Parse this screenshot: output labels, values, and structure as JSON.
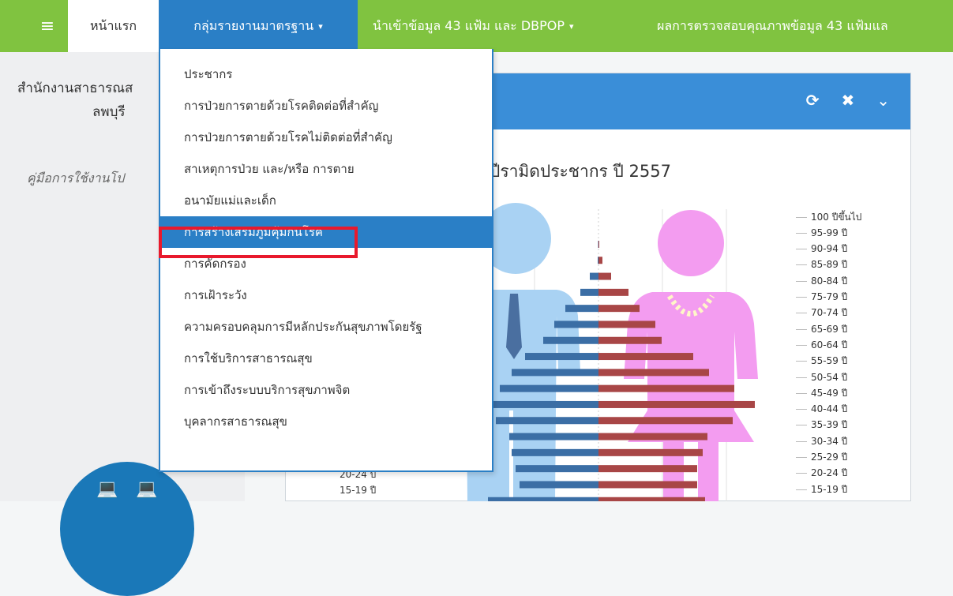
{
  "navbar": {
    "menu_icon": "≡",
    "home": "หน้าแรก",
    "standard_reports": "กลุ่มรายงานมาตรฐาน",
    "import_data": "นำเข้าข้อมูล 43 แฟ้ม และ DBPOP",
    "quality": "ผลการตรวจสอบคุณภาพข้อมูล 43 แฟ้มแล",
    "caret": "▾"
  },
  "sidebar": {
    "org_line1": "สำนักงานสาธารณส",
    "org_line2": "ลพบุรี",
    "manual": "คู่มือการใช้งานโป"
  },
  "dropdown": {
    "items": [
      {
        "label": "ประชากร"
      },
      {
        "label": "การป่วยการตายด้วยโรคติดต่อที่สำคัญ"
      },
      {
        "label": "การป่วยการตายด้วยโรคไม่ติดต่อที่สำคัญ"
      },
      {
        "label": "สาเหตุการป่วย และ/หรือ การตาย"
      },
      {
        "label": "อนามัยแม่และเด็ก"
      },
      {
        "label": "การสร้างเสริมภูมิคุ้มกันโรค"
      },
      {
        "label": "การคัดกรอง"
      },
      {
        "label": "การเฝ้าระวัง"
      },
      {
        "label": "ความครอบคลุมการมีหลักประกันสุขภาพโดยรัฐ"
      },
      {
        "label": "การใช้บริการสาธารณสุข"
      },
      {
        "label": "การเข้าถึงระบบบริการสุขภาพจิต"
      },
      {
        "label": "บุคลากรสาธารณสุข"
      }
    ],
    "active_index": 5
  },
  "panel": {
    "refresh_icon": "⟳",
    "close_icon": "✖",
    "collapse_icon": "⌄"
  },
  "chart_data": {
    "type": "bar",
    "title": "ปีรามิดประชากร ปี 2557",
    "categories": [
      "100 ปีขึ้นไป",
      "95-99 ปี",
      "90-94 ปี",
      "85-89 ปี",
      "80-84 ปี",
      "75-79 ปี",
      "70-74 ปี",
      "65-69 ปี",
      "60-64 ปี",
      "55-59 ปี",
      "50-54 ปี",
      "45-49 ปี",
      "40-44 ปี",
      "35-39 ปี",
      "30-34 ปี",
      "25-29 ปี",
      "20-24 ปี",
      "15-19 ปี"
    ],
    "left_axis_visible": [
      "20-24 ปี",
      "15-19 ปี"
    ],
    "series": [
      {
        "color": "#3b6ea5",
        "values": [
          0,
          0.5,
          1,
          11,
          23,
          42,
          56,
          70,
          93,
          110,
          125,
          140,
          130,
          113,
          110,
          105,
          100,
          140
        ]
      },
      {
        "color": "#a84646",
        "values": [
          0,
          1,
          5,
          16,
          38,
          52,
          72,
          80,
          120,
          140,
          172,
          198,
          170,
          138,
          132,
          125,
          125,
          135
        ]
      }
    ]
  },
  "colors": {
    "navbar": "#80c340",
    "active_nav": "#2a7fc6",
    "panel_header": "#3a8ed8",
    "highlight": "#e8192c"
  }
}
